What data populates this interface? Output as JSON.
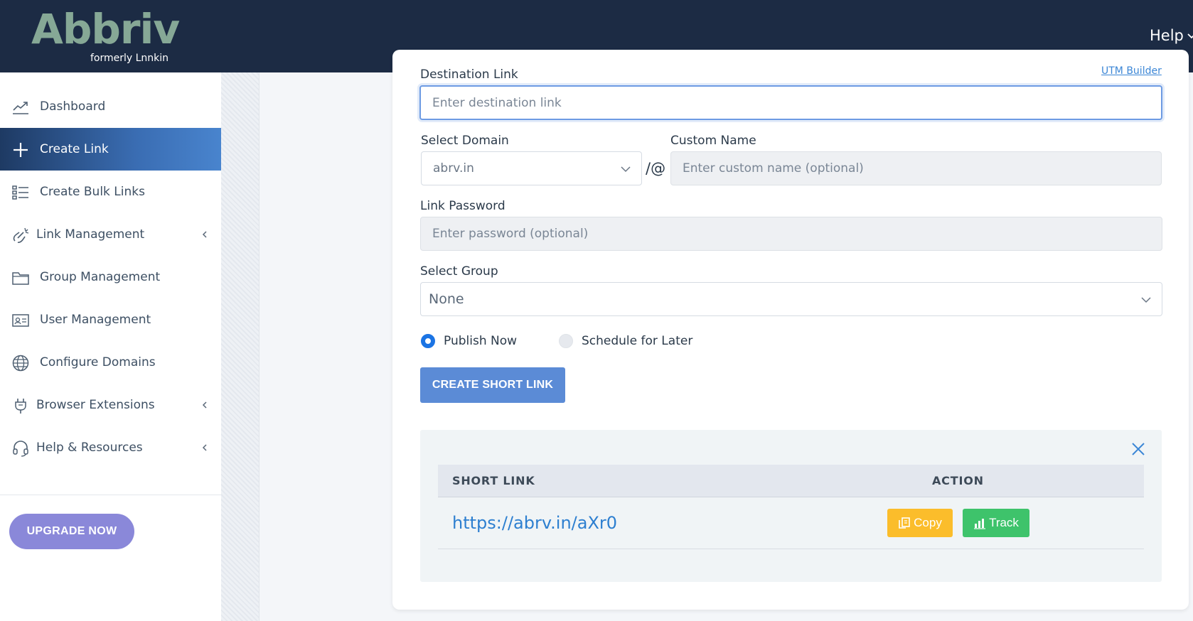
{
  "header": {
    "logo_text": "Abbriv",
    "logo_subtitle": "formerly Lnnkin",
    "help_label": "Help"
  },
  "sidebar": {
    "items": [
      {
        "label": "Dashboard",
        "icon": "trend-chart-icon"
      },
      {
        "label": "Create Link",
        "icon": "plus-icon",
        "active": true
      },
      {
        "label": "Create Bulk Links",
        "icon": "list-icon"
      },
      {
        "label": "Link Management",
        "icon": "link-edit-icon",
        "expandable": true
      },
      {
        "label": "Group Management",
        "icon": "folder-icon"
      },
      {
        "label": "User Management",
        "icon": "id-card-icon"
      },
      {
        "label": "Configure Domains",
        "icon": "globe-icon"
      },
      {
        "label": "Browser Extensions",
        "icon": "plug-icon",
        "expandable": true
      },
      {
        "label": "Help & Resources",
        "icon": "headset-icon",
        "expandable": true
      }
    ],
    "upgrade_label": "UPGRADE NOW"
  },
  "form": {
    "destination": {
      "label": "Destination Link",
      "placeholder": "Enter destination link",
      "value": ""
    },
    "utm_builder_label": "UTM Builder",
    "domain": {
      "label": "Select Domain",
      "selected": "abrv.in"
    },
    "separator": "/@",
    "custom_name": {
      "label": "Custom Name",
      "placeholder": "Enter custom name (optional)",
      "value": ""
    },
    "password": {
      "label": "Link Password",
      "placeholder": "Enter password (optional)",
      "value": ""
    },
    "group": {
      "label": "Select Group",
      "selected": "None"
    },
    "publish_now_label": "Publish Now",
    "schedule_label": "Schedule for Later",
    "submit_label": "CREATE SHORT LINK"
  },
  "result": {
    "columns": [
      "SHORT LINK",
      "ACTION"
    ],
    "rows": [
      {
        "short_link": "https://abrv.in/aXr0"
      }
    ],
    "copy_label": "Copy",
    "track_label": "Track"
  },
  "colors": {
    "header_bg": "#1c2b44",
    "logo": "#86a896",
    "active_nav": "#3a6db3",
    "primary": "#5b8bd6",
    "upgrade": "#8a88d9",
    "copy": "#fbbd2b",
    "track": "#3ec36b",
    "link": "#2d7fd0"
  }
}
